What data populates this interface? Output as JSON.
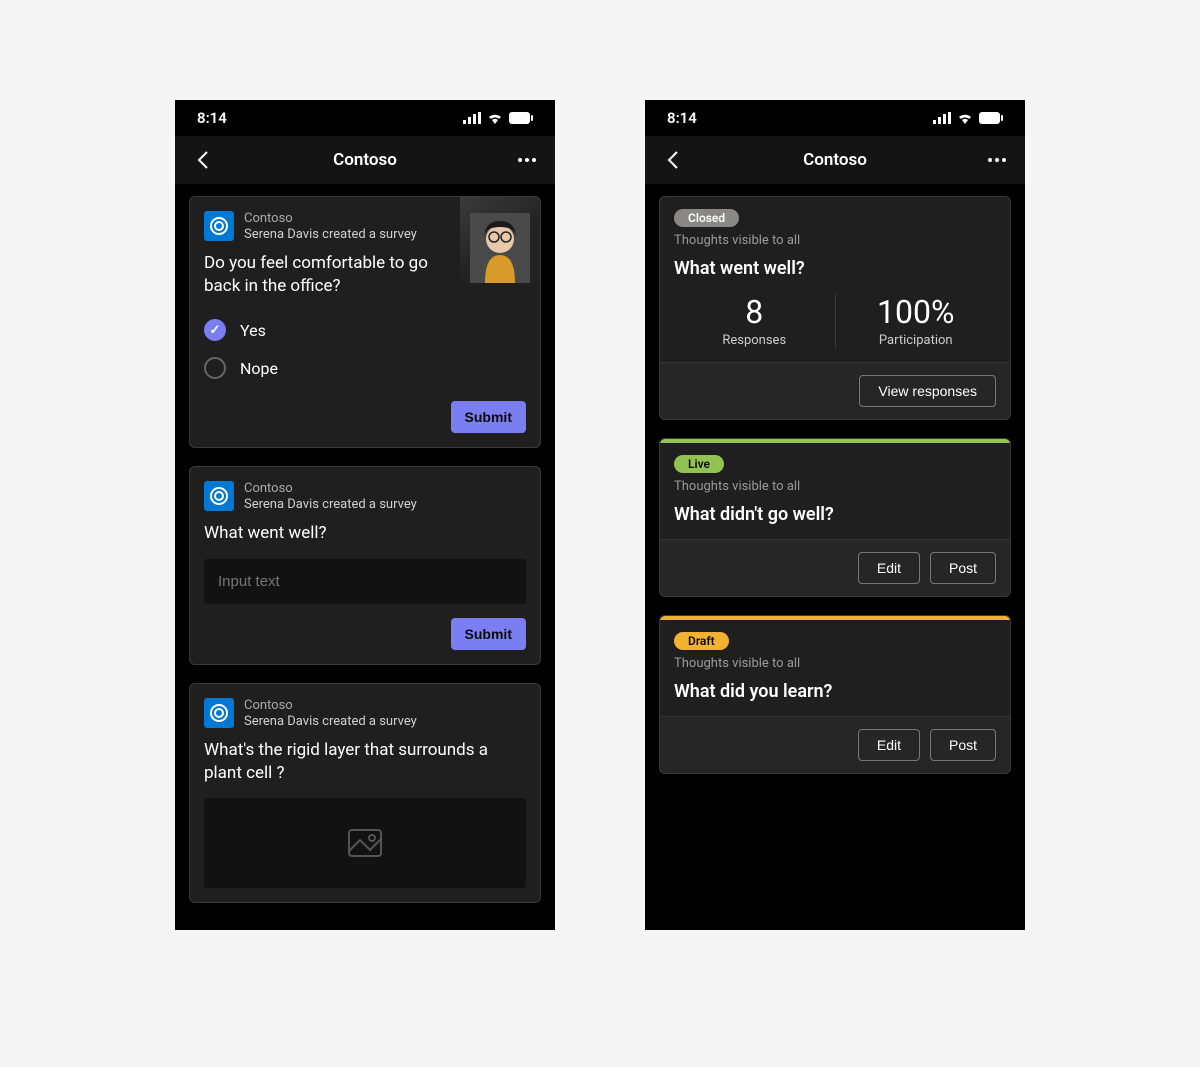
{
  "status": {
    "time": "8:14"
  },
  "nav": {
    "title": "Contoso"
  },
  "colors": {
    "primary": "#7b7ef0",
    "closed_badge": "#8a8886",
    "live_badge": "#92c353",
    "draft_badge": "#f2b231",
    "live_stripe": "#92c353",
    "draft_stripe": "#f2b231"
  },
  "left": {
    "app_name": "Contoso",
    "subtitle": "Serena Davis created a survey",
    "card1": {
      "question": "Do you feel comfortable to go back in the office?",
      "options": [
        "Yes",
        "Nope"
      ],
      "selected": 0,
      "submit": "Submit"
    },
    "card2": {
      "question": "What went well?",
      "placeholder": "Input text",
      "submit": "Submit"
    },
    "card3": {
      "question": "What's the rigid layer that surrounds a plant cell ?"
    }
  },
  "right": {
    "closed": {
      "badge": "Closed",
      "visibility": "Thoughts visible to all",
      "question": "What went well?",
      "responses_num": "8",
      "responses_label": "Responses",
      "participation_num": "100%",
      "participation_label": "Participation",
      "action": "View responses"
    },
    "live": {
      "badge": "Live",
      "visibility": "Thoughts visible to all",
      "question": "What didn't go well?",
      "edit": "Edit",
      "post": "Post"
    },
    "draft": {
      "badge": "Draft",
      "visibility": "Thoughts visible to all",
      "question": "What did you learn?",
      "edit": "Edit",
      "post": "Post"
    }
  }
}
